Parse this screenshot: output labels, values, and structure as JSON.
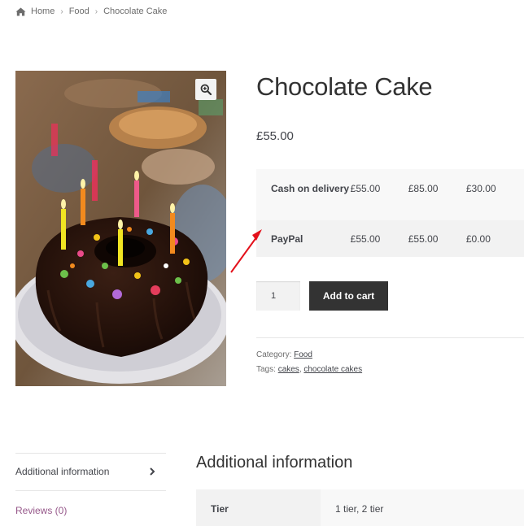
{
  "breadcrumb": {
    "home": "Home",
    "category": "Food",
    "current": "Chocolate Cake",
    "separator": "›"
  },
  "product": {
    "title": "Chocolate Cake",
    "price": "£55.00",
    "payment_table": [
      {
        "method": "Cash on delivery",
        "v1": "£55.00",
        "v2": "£85.00",
        "v3": "£30.00"
      },
      {
        "method": "PayPal",
        "v1": "£55.00",
        "v2": "£55.00",
        "v3": "£0.00"
      }
    ],
    "quantity": "1",
    "add_to_cart": "Add to cart",
    "category_label": "Category:",
    "category_link": "Food",
    "tags_label": "Tags:",
    "tag1": "cakes",
    "tag_separator": ",",
    "tag2": "chocolate cakes",
    "zoom_icon": "magnifier-plus-icon"
  },
  "tabs": {
    "additional": "Additional information",
    "reviews": "Reviews (0)"
  },
  "additional_info": {
    "title": "Additional information",
    "attribute": "Tier",
    "value": "1 tier, 2 tier"
  },
  "colors": {
    "button_bg": "#333333",
    "link_purple": "#96588a",
    "annotation_arrow": "#e3111b"
  }
}
